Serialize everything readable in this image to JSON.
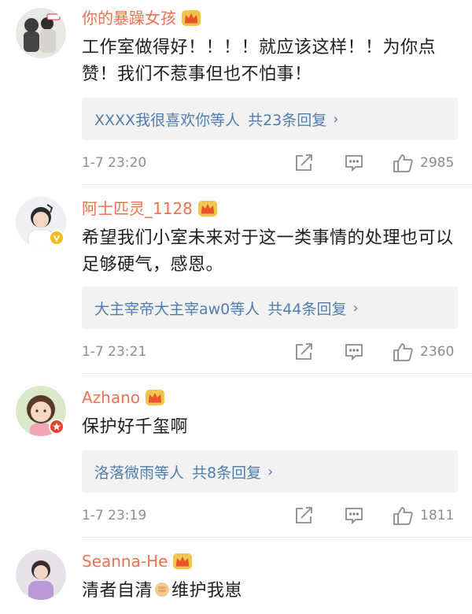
{
  "comments": [
    {
      "username": "你的暴躁女孩",
      "text": "工作室做得好！！！！就应该这样！！为你点赞！我们不惹事但也不怕事！",
      "reply_users": "XXXX我很喜欢你等人",
      "reply_count": "共23条回复",
      "time": "1-7 23:20",
      "likes": "2985"
    },
    {
      "username": "阿士匹灵_1128",
      "text": "希望我们小室未来对于这一类事情的处理也可以足够硬气，感恩。",
      "reply_users": "大主宰帝大主宰aw0等人",
      "reply_count": "共44条回复",
      "time": "1-7 23:21",
      "likes": "2360"
    },
    {
      "username": "Azhano",
      "text": "保护好千玺啊",
      "reply_users": "洛落微雨等人",
      "reply_count": "共8条回复",
      "time": "1-7 23:19",
      "likes": "1811"
    },
    {
      "username": "Seanna-He",
      "text_before": "清者自清",
      "text_after": "维护我崽"
    }
  ],
  "icons": {
    "share": "share-icon",
    "comment": "comment-icon",
    "like": "thumbs-up-icon",
    "crown": "crown-badge-icon",
    "reply_chevron": "chevron-right-icon"
  },
  "reply_chevron": "›",
  "colors": {
    "username": "#eb7350",
    "link": "#507daf",
    "meta": "#8c8c8c",
    "reply_bg": "#f2f2f2"
  }
}
